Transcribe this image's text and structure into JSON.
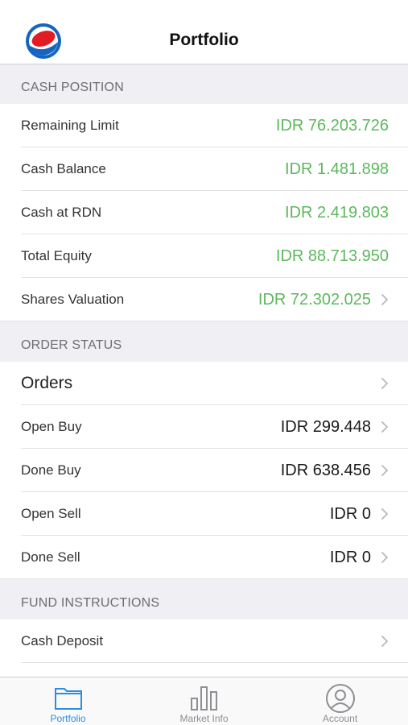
{
  "header": {
    "title": "Portfolio",
    "logo_icon": "pepsi-style-logo"
  },
  "sections": [
    {
      "title": "CASH POSITION",
      "rows": [
        {
          "label": "Remaining Limit",
          "value": "IDR 76.203.726",
          "chevron": false
        },
        {
          "label": "Cash Balance",
          "value": "IDR 1.481.898",
          "chevron": false
        },
        {
          "label": "Cash at RDN",
          "value": "IDR 2.419.803",
          "chevron": false
        },
        {
          "label": "Total Equity",
          "value": "IDR 88.713.950",
          "chevron": false
        },
        {
          "label": "Shares Valuation",
          "value": "IDR 72.302.025",
          "chevron": true
        }
      ]
    },
    {
      "title": "ORDER STATUS",
      "rows": [
        {
          "label": "Orders",
          "value": "",
          "chevron": true
        },
        {
          "label": "Open Buy",
          "value": "IDR 299.448",
          "chevron": true
        },
        {
          "label": "Done Buy",
          "value": "IDR 638.456",
          "chevron": true
        },
        {
          "label": "Open Sell",
          "value": "IDR 0",
          "chevron": true
        },
        {
          "label": "Done Sell",
          "value": "IDR 0",
          "chevron": true
        }
      ]
    },
    {
      "title": "FUND INSTRUCTIONS",
      "rows": [
        {
          "label": "Cash Deposit",
          "value": "",
          "chevron": true
        }
      ]
    }
  ],
  "tabbar": {
    "tabs": [
      {
        "label": "Portfolio",
        "icon": "folder-icon",
        "active": true
      },
      {
        "label": "Market Info",
        "icon": "bar-chart-icon",
        "active": false
      },
      {
        "label": "Account",
        "icon": "user-icon",
        "active": false
      }
    ]
  },
  "colors": {
    "positive_value": "#5cb85c",
    "accent": "#2b8de3",
    "inactive": "#8e8e93",
    "section_bg": "#efeff4"
  }
}
